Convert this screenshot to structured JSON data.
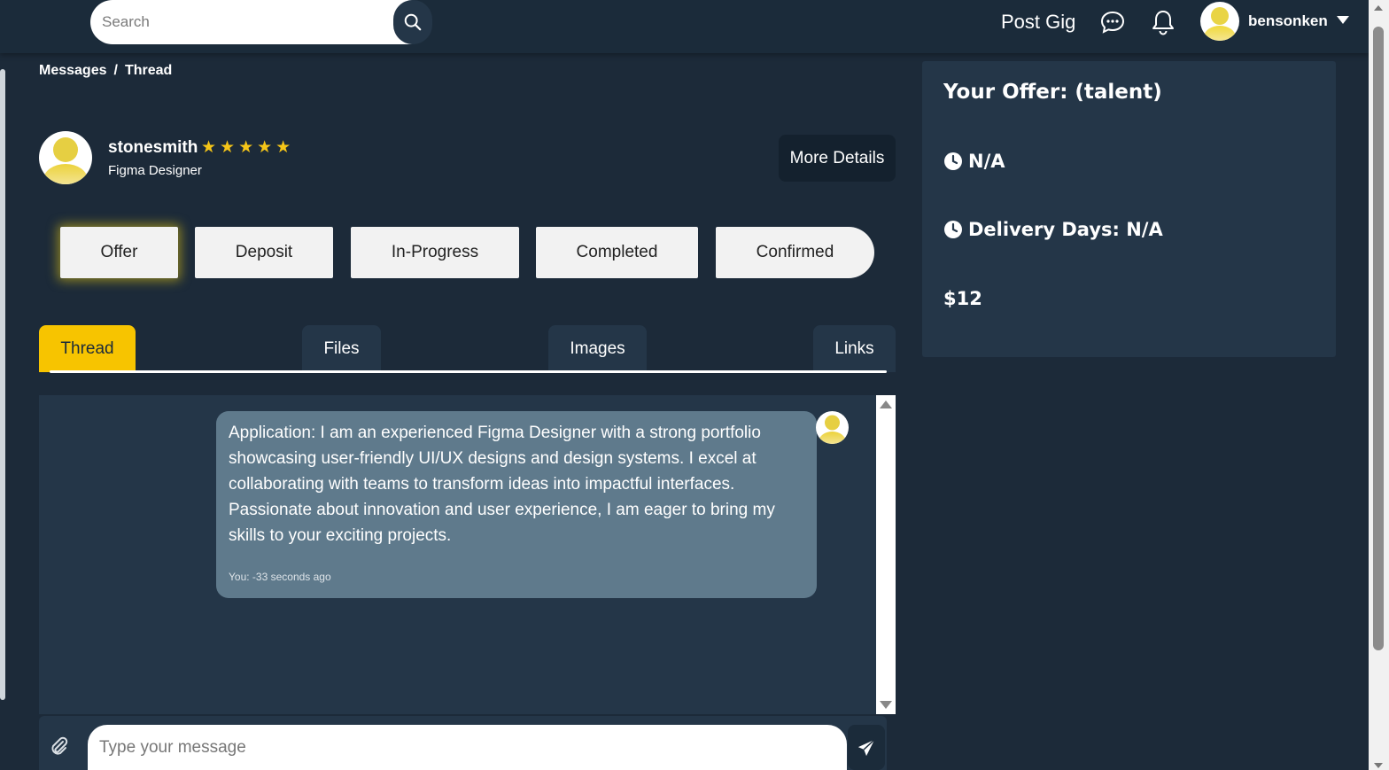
{
  "header": {
    "search_placeholder": "Search",
    "post_gig": "Post Gig",
    "username": "bensonken"
  },
  "breadcrumb": {
    "messages": "Messages",
    "separator": "/",
    "thread": "Thread"
  },
  "profile": {
    "name": "stonesmith",
    "stars": "★★★★★",
    "rating": 5,
    "role": "Figma Designer",
    "more_details": "More Details"
  },
  "steps": [
    "Offer",
    "Deposit",
    "In-Progress",
    "Completed",
    "Confirmed"
  ],
  "active_step": "Offer",
  "tabs": [
    "Thread",
    "Files",
    "Images",
    "Links"
  ],
  "active_tab": "Thread",
  "message": {
    "text": "Application: I am an experienced Figma Designer with a strong portfolio showcasing user-friendly UI/UX designs and design systems. I excel at collaborating with teams to transform ideas into impactful interfaces. Passionate about innovation and user experience, I am eager to bring my skills to your exciting projects.",
    "meta": "You: -33 seconds ago"
  },
  "composer": {
    "placeholder": "Type your message"
  },
  "offer": {
    "title": "Your Offer: (talent)",
    "time": "N/A",
    "delivery": "Delivery Days: N/A",
    "price": "$12"
  },
  "colors": {
    "background": "#1c2a39",
    "panel": "#243648",
    "accent": "#f7c400",
    "bubble": "#5f7a8c",
    "star": "#f5c518"
  }
}
